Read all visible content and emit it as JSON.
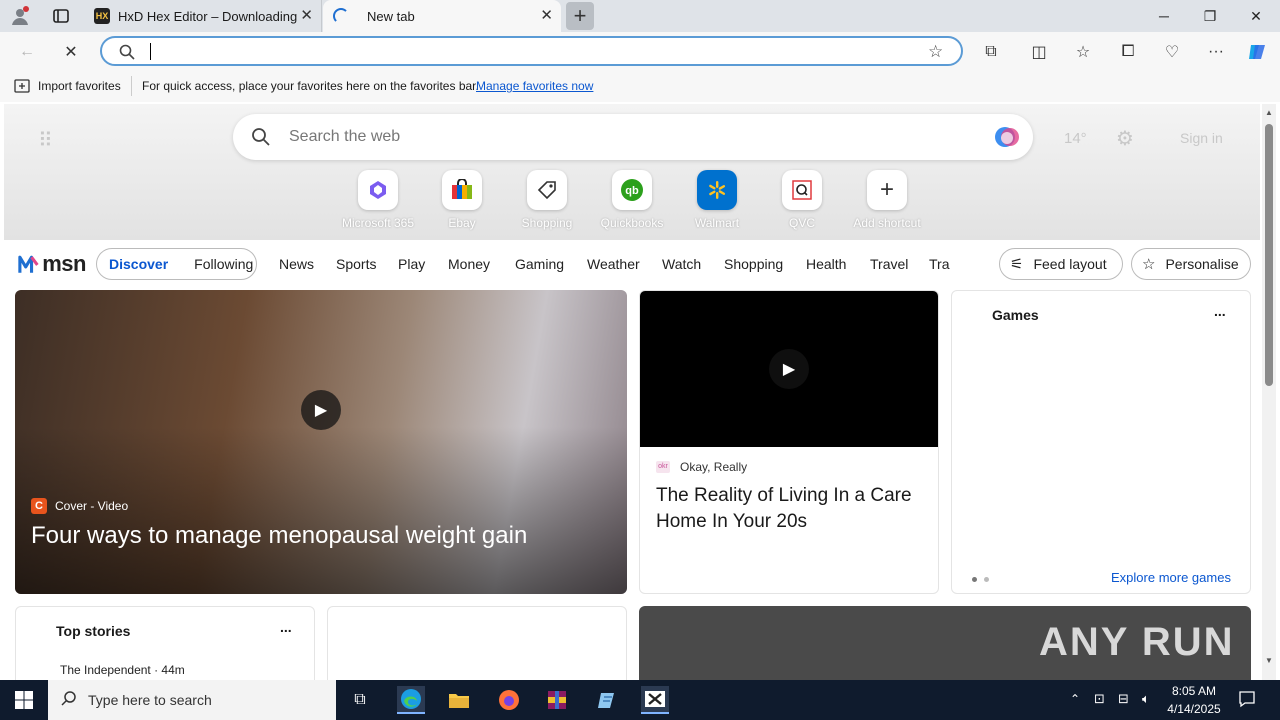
{
  "browser": {
    "tabs": [
      {
        "title": "HxD Hex Editor – Downloading",
        "icon": "hxd-app-icon"
      },
      {
        "title": "New tab",
        "icon": "loading-spinner-icon"
      }
    ],
    "address_bar": {
      "value": "",
      "placeholder": ""
    },
    "favorites_bar": {
      "import_label": "Import favorites",
      "hint": "For quick access, place your favorites here on the favorites bar.",
      "manage_link": "Manage favorites now"
    }
  },
  "newtab": {
    "search_placeholder": "Search the web",
    "weather_temp": "14°",
    "sign_in": "Sign in",
    "shortcuts": [
      {
        "label": "Microsoft 365",
        "icon": "microsoft-365-icon"
      },
      {
        "label": "Ebay",
        "icon": "ebay-bag-icon"
      },
      {
        "label": "Shopping",
        "icon": "shopping-tag-icon"
      },
      {
        "label": "Quickbooks",
        "icon": "quickbooks-icon"
      },
      {
        "label": "Walmart",
        "icon": "walmart-spark-icon"
      },
      {
        "label": "QVC",
        "icon": "qvc-icon"
      },
      {
        "label": "Add shortcut",
        "icon": "plus-icon"
      }
    ],
    "msn_logo": "msn",
    "nav": {
      "pills": [
        "Discover",
        "Following"
      ],
      "items": [
        "News",
        "Sports",
        "Play",
        "Money",
        "Gaming",
        "Weather",
        "Watch",
        "Shopping",
        "Health",
        "Travel",
        "Tra"
      ],
      "feed_layout": "Feed layout",
      "personalise": "Personalise"
    },
    "featured": {
      "source": "Cover - Video",
      "source_badge": "C",
      "title": "Four ways to manage menopausal weight gain"
    },
    "video_card": {
      "source": "Okay, Really",
      "title": "The Reality of Living In a Care Home In Your 20s"
    },
    "games_card": {
      "title": "Games",
      "more": "...",
      "explore": "Explore more games"
    },
    "top_stories": {
      "title": "Top stories",
      "more": "...",
      "first_source": "The Independent · 44m"
    },
    "watermark": "ANY RUN"
  },
  "taskbar": {
    "search_placeholder": "Type here to search",
    "time": "8:05 AM",
    "date": "4/14/2025"
  },
  "colors": {
    "accent": "#0b57d0",
    "taskbar": "#0f1b2d",
    "address_border": "#5b9bd5"
  }
}
